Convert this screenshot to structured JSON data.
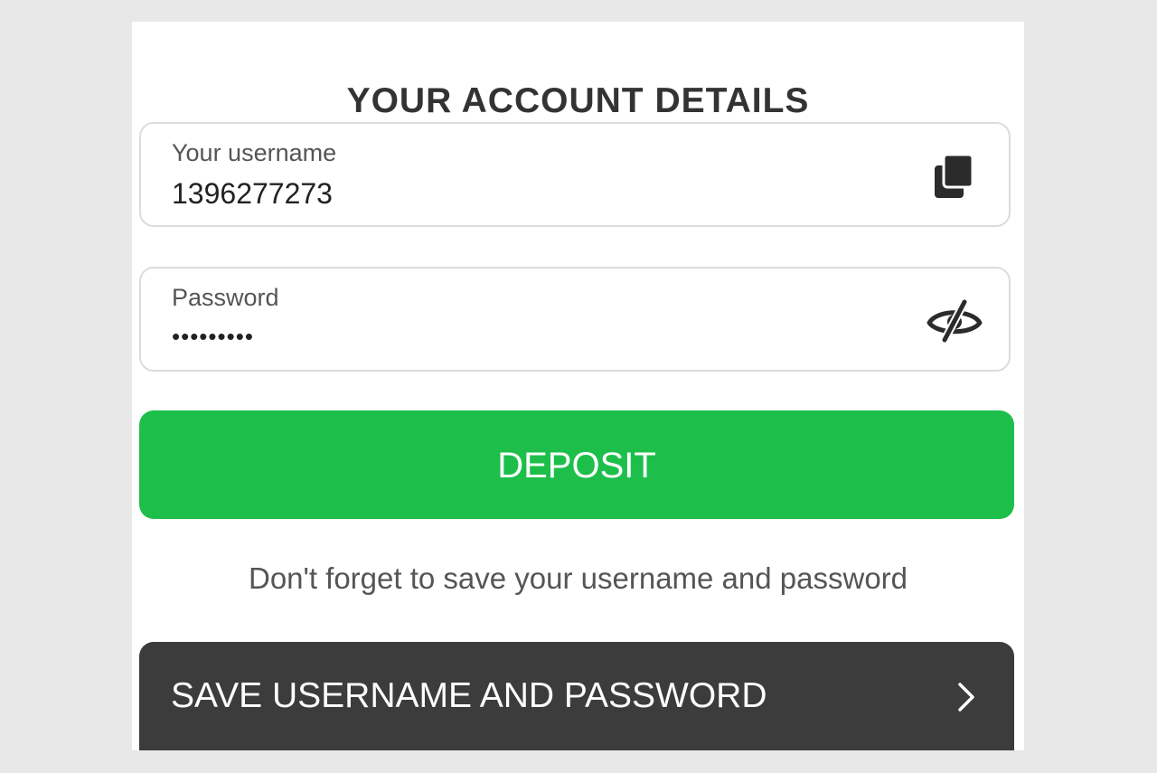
{
  "title": "YOUR ACCOUNT DETAILS",
  "username_field": {
    "label": "Your username",
    "value": "1396277273",
    "icon": "copy-icon"
  },
  "password_field": {
    "label": "Password",
    "value": "•••••••••",
    "icon": "eye-slash-icon"
  },
  "deposit_button": {
    "label": "DEPOSIT",
    "color": "#1dbf4a"
  },
  "reminder_text": "Don't forget to save your username and password",
  "save_button": {
    "label": "SAVE USERNAME AND PASSWORD",
    "icon": "chevron-right-icon",
    "color": "#3c3c3c"
  }
}
